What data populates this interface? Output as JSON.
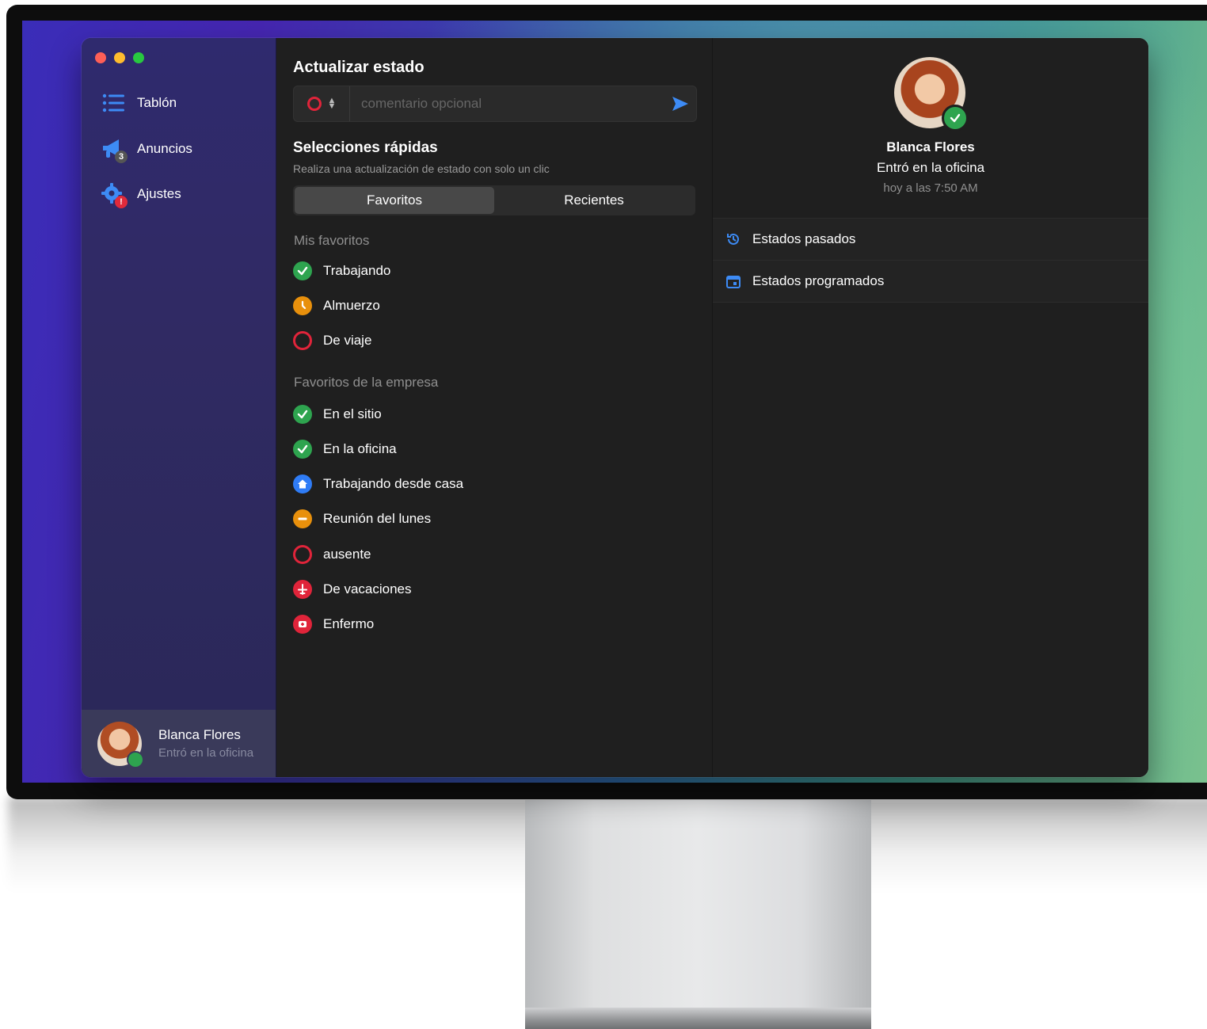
{
  "sidebar": {
    "items": [
      {
        "label": "Tablón",
        "icon": "list-icon"
      },
      {
        "label": "Anuncios",
        "icon": "megaphone-icon",
        "badge": "3"
      },
      {
        "label": "Ajustes",
        "icon": "gear-icon",
        "badge": "!"
      }
    ],
    "profile": {
      "name": "Blanca Flores",
      "status": "Entró en la oficina"
    }
  },
  "update": {
    "title": "Actualizar estado",
    "comment_placeholder": "comentario opcional"
  },
  "quick": {
    "title": "Selecciones rápidas",
    "description": "Realiza una actualización de estado con solo un clic",
    "tabs": [
      {
        "label": "Favoritos",
        "active": true
      },
      {
        "label": "Recientes",
        "active": false
      }
    ],
    "my_favorites_label": "Mis favoritos",
    "my_favorites": [
      {
        "label": "Trabajando",
        "icon": "check-icon",
        "color": "#2ea44f"
      },
      {
        "label": "Almuerzo",
        "icon": "clock-icon",
        "color": "#e8900c"
      },
      {
        "label": "De viaje",
        "icon": "ring-icon",
        "color": "#e0243a"
      }
    ],
    "company_favorites_label": "Favoritos de la empresa",
    "company_favorites": [
      {
        "label": "En el sitio",
        "icon": "check-icon",
        "color": "#2ea44f"
      },
      {
        "label": "En la oficina",
        "icon": "check-icon",
        "color": "#2ea44f"
      },
      {
        "label": "Trabajando desde casa",
        "icon": "home-icon",
        "color": "#2f7cf6"
      },
      {
        "label": "Reunión del lunes",
        "icon": "minus-icon",
        "color": "#e8900c"
      },
      {
        "label": "ausente",
        "icon": "ring-icon",
        "color": "#e0243a"
      },
      {
        "label": "De vacaciones",
        "icon": "plane-icon",
        "color": "#e0243a"
      },
      {
        "label": "Enfermo",
        "icon": "medical-icon",
        "color": "#e0243a"
      }
    ]
  },
  "detail": {
    "name": "Blanca Flores",
    "status": "Entró en la oficina",
    "time": "hoy a las 7:50 AM",
    "rows": [
      {
        "label": "Estados pasados",
        "icon": "history-icon"
      },
      {
        "label": "Estados programados",
        "icon": "calendar-icon"
      }
    ]
  }
}
